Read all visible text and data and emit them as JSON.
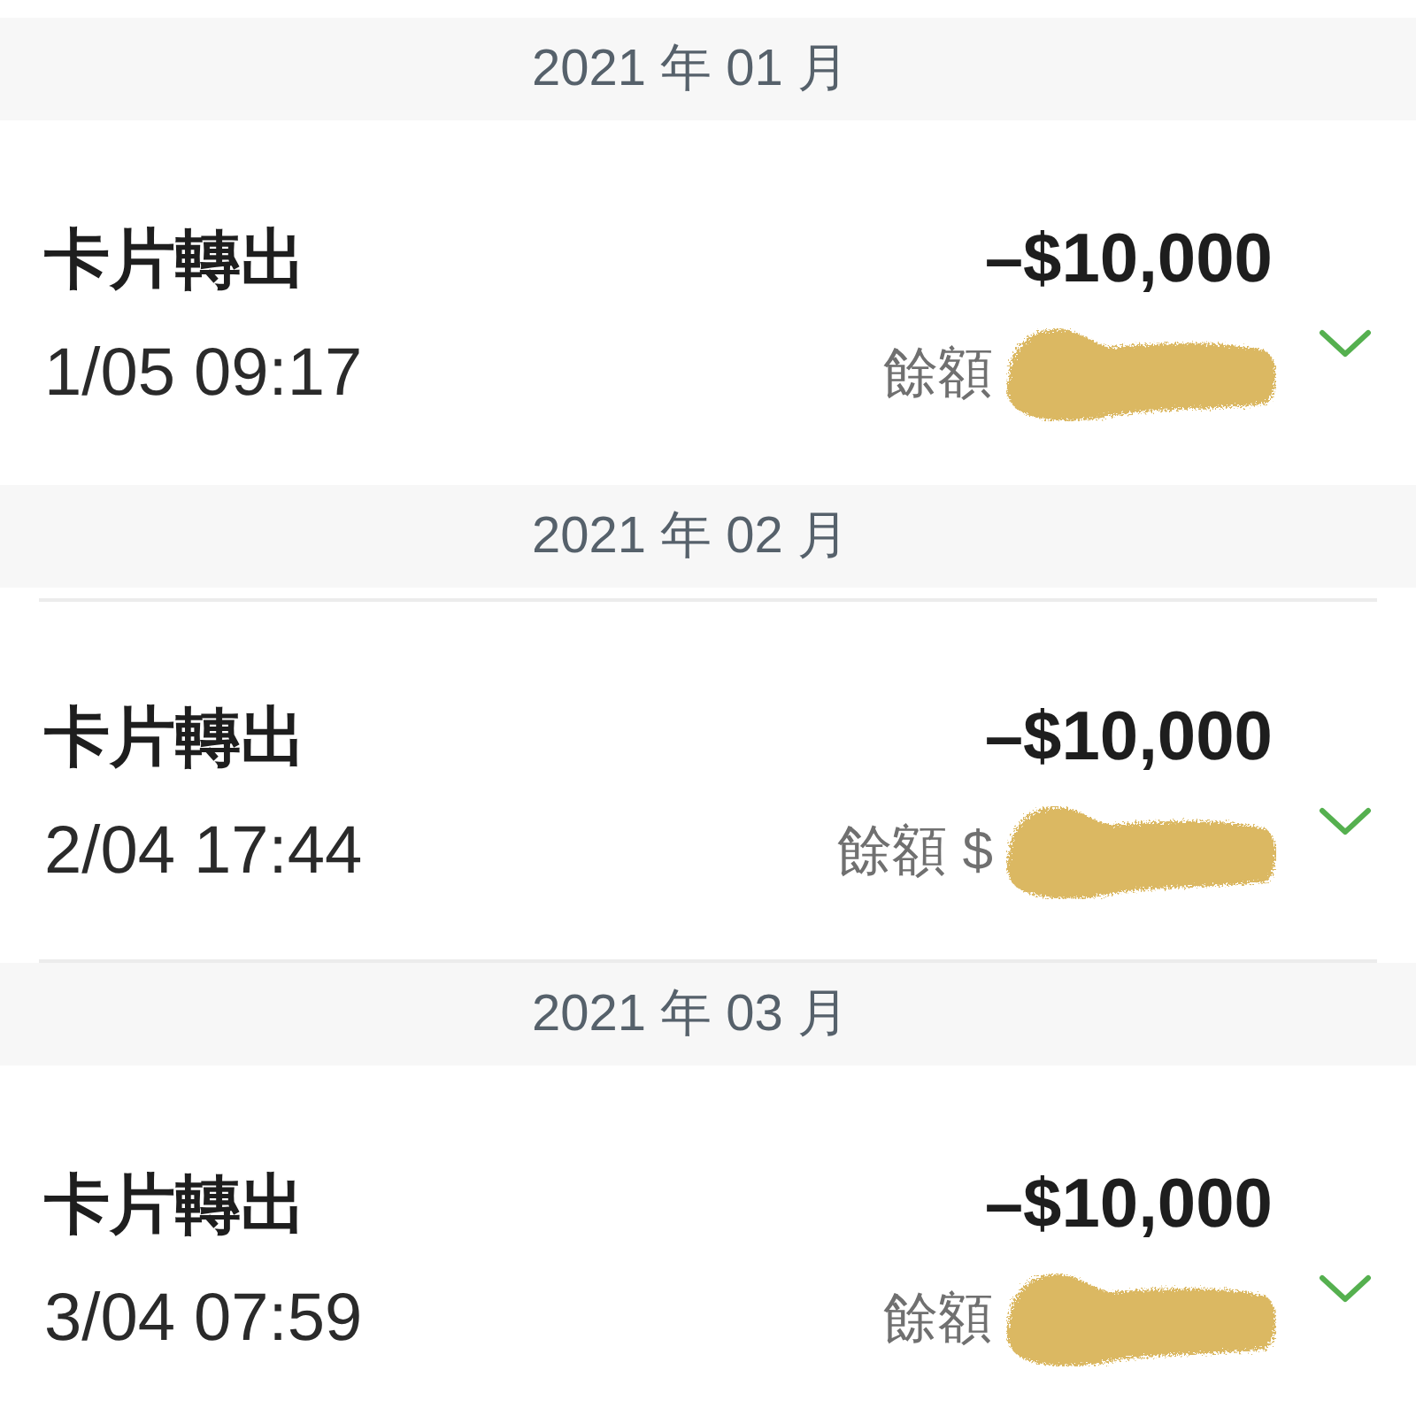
{
  "sections": [
    {
      "month": "2021 年 01 月",
      "ruled": false,
      "transaction": {
        "title": "卡片轉出",
        "amount": "–$10,000",
        "datetime": "1/05 09:17",
        "balance_label": "餘額"
      }
    },
    {
      "month": "2021 年 02 月",
      "ruled": true,
      "transaction": {
        "title": "卡片轉出",
        "amount": "–$10,000",
        "datetime": "2/04 17:44",
        "balance_label": "餘額 $"
      }
    },
    {
      "month": "2021 年 03 月",
      "ruled": false,
      "transaction": {
        "title": "卡片轉出",
        "amount": "–$10,000",
        "datetime": "3/04 07:59",
        "balance_label": "餘額"
      }
    }
  ]
}
